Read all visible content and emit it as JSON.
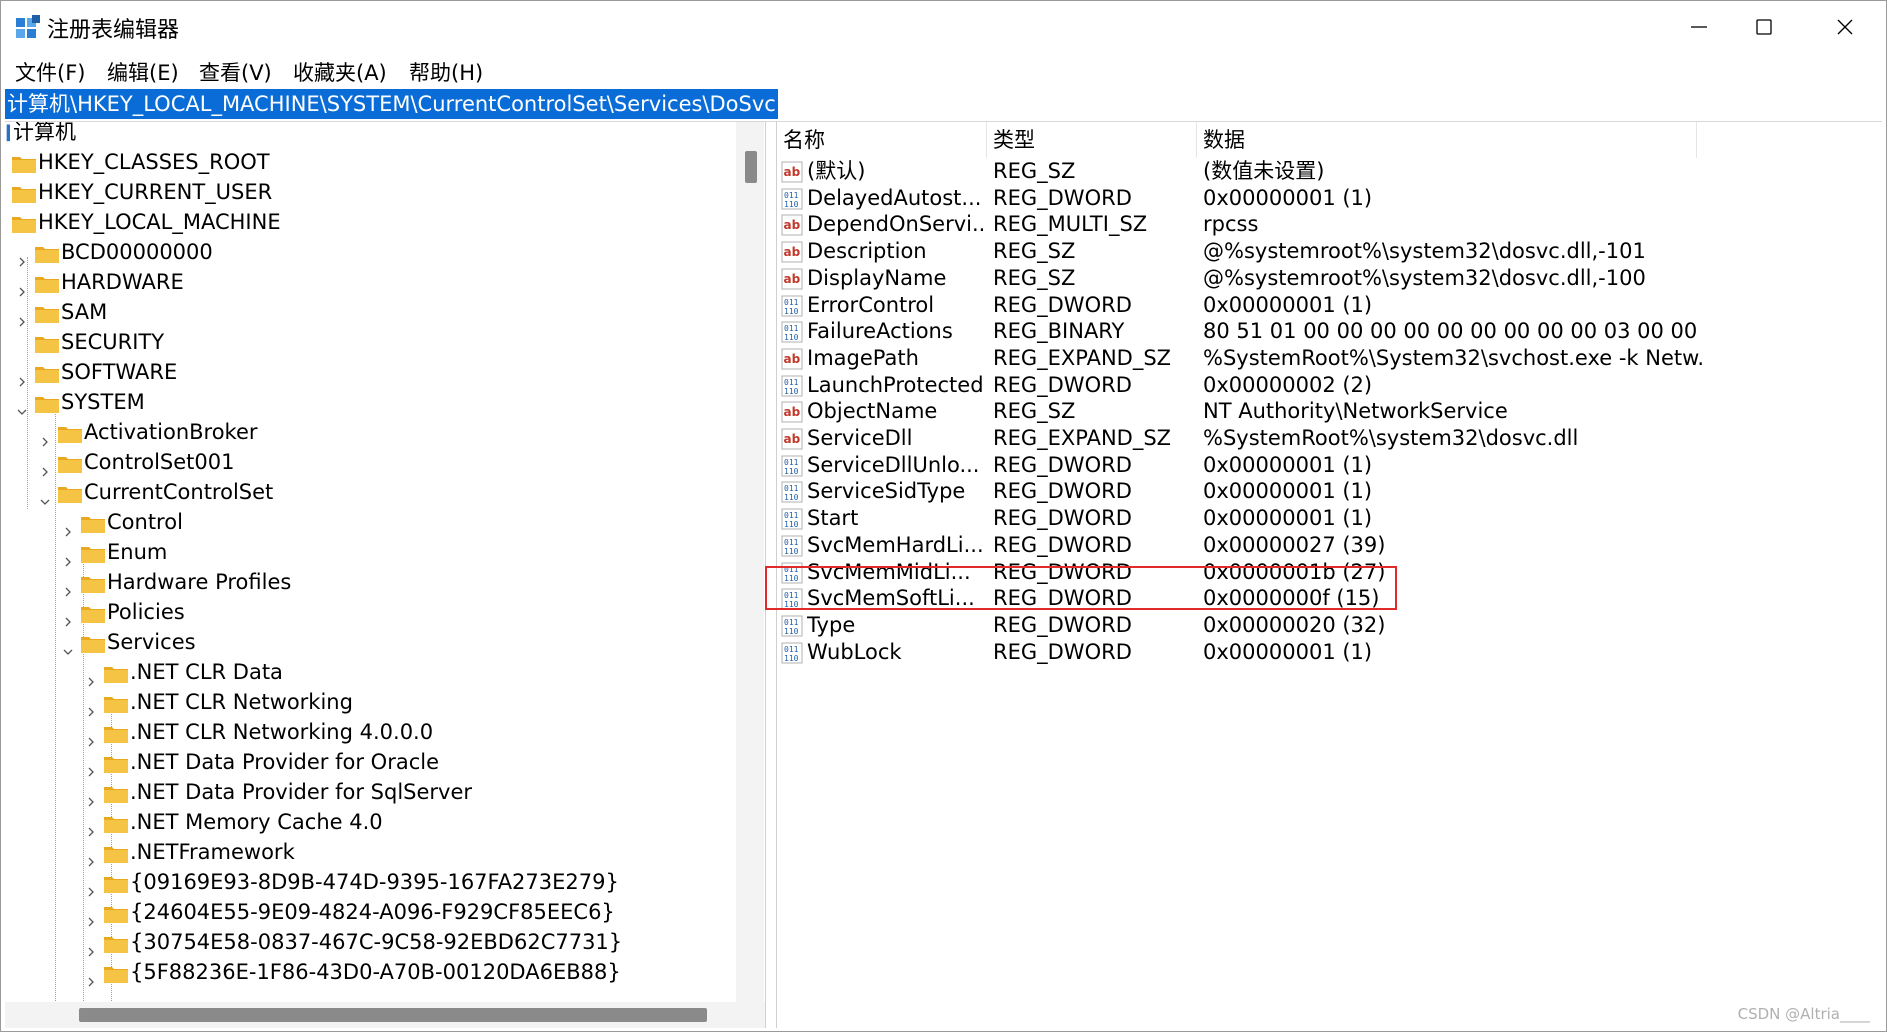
{
  "window": {
    "title": "注册表编辑器"
  },
  "menu": [
    "文件(F)",
    "编辑(E)",
    "查看(V)",
    "收藏夹(A)",
    "帮助(H)"
  ],
  "address": "计算机\\HKEY_LOCAL_MACHINE\\SYSTEM\\CurrentControlSet\\Services\\DoSvc",
  "tree": [
    {
      "label": "计算机",
      "level": 0,
      "chev": "none",
      "folder": false
    },
    {
      "label": "HKEY_CLASSES_ROOT",
      "level": 1,
      "chev": "none",
      "folder": true
    },
    {
      "label": "HKEY_CURRENT_USER",
      "level": 1,
      "chev": "none",
      "folder": true
    },
    {
      "label": "HKEY_LOCAL_MACHINE",
      "level": 1,
      "chev": "none",
      "folder": true
    },
    {
      "label": "BCD00000000",
      "level": 2,
      "chev": "right",
      "folder": true
    },
    {
      "label": "HARDWARE",
      "level": 2,
      "chev": "right",
      "folder": true
    },
    {
      "label": "SAM",
      "level": 2,
      "chev": "right",
      "folder": true
    },
    {
      "label": "SECURITY",
      "level": 2,
      "chev": "none",
      "folder": true
    },
    {
      "label": "SOFTWARE",
      "level": 2,
      "chev": "right",
      "folder": true
    },
    {
      "label": "SYSTEM",
      "level": 2,
      "chev": "down",
      "folder": true
    },
    {
      "label": "ActivationBroker",
      "level": 3,
      "chev": "right",
      "folder": true
    },
    {
      "label": "ControlSet001",
      "level": 3,
      "chev": "right",
      "folder": true
    },
    {
      "label": "CurrentControlSet",
      "level": 3,
      "chev": "down",
      "folder": true
    },
    {
      "label": "Control",
      "level": 4,
      "chev": "right",
      "folder": true
    },
    {
      "label": "Enum",
      "level": 4,
      "chev": "right",
      "folder": true
    },
    {
      "label": "Hardware Profiles",
      "level": 4,
      "chev": "right",
      "folder": true
    },
    {
      "label": "Policies",
      "level": 4,
      "chev": "right",
      "folder": true
    },
    {
      "label": "Services",
      "level": 4,
      "chev": "down",
      "folder": true
    },
    {
      "label": ".NET CLR Data",
      "level": 5,
      "chev": "right",
      "folder": true
    },
    {
      "label": ".NET CLR Networking",
      "level": 5,
      "chev": "right",
      "folder": true
    },
    {
      "label": ".NET CLR Networking 4.0.0.0",
      "level": 5,
      "chev": "right",
      "folder": true
    },
    {
      "label": ".NET Data Provider for Oracle",
      "level": 5,
      "chev": "right",
      "folder": true
    },
    {
      "label": ".NET Data Provider for SqlServer",
      "level": 5,
      "chev": "right",
      "folder": true
    },
    {
      "label": ".NET Memory Cache 4.0",
      "level": 5,
      "chev": "right",
      "folder": true
    },
    {
      "label": ".NETFramework",
      "level": 5,
      "chev": "right",
      "folder": true
    },
    {
      "label": "{09169E93-8D9B-474D-9395-167FA273E279}",
      "level": 5,
      "chev": "right",
      "folder": true
    },
    {
      "label": "{24604E55-9E09-4824-A096-F929CF85EEC6}",
      "level": 5,
      "chev": "right",
      "folder": true
    },
    {
      "label": "{30754E58-0837-467C-9C58-92EBD62C7731}",
      "level": 5,
      "chev": "right",
      "folder": true
    },
    {
      "label": "{5F88236E-1F86-43D0-A70B-00120DA6EB88}",
      "level": 5,
      "chev": "right",
      "folder": true
    }
  ],
  "columns": [
    "名称",
    "类型",
    "数据"
  ],
  "values": [
    {
      "icon": "ab",
      "name": "(默认)",
      "type": "REG_SZ",
      "data": "(数值未设置)"
    },
    {
      "icon": "bin",
      "name": "DelayedAutost...",
      "type": "REG_DWORD",
      "data": "0x00000001 (1)"
    },
    {
      "icon": "ab",
      "name": "DependOnServi...",
      "type": "REG_MULTI_SZ",
      "data": "rpcss"
    },
    {
      "icon": "ab",
      "name": "Description",
      "type": "REG_SZ",
      "data": "@%systemroot%\\system32\\dosvc.dll,-101"
    },
    {
      "icon": "ab",
      "name": "DisplayName",
      "type": "REG_SZ",
      "data": "@%systemroot%\\system32\\dosvc.dll,-100"
    },
    {
      "icon": "bin",
      "name": "ErrorControl",
      "type": "REG_DWORD",
      "data": "0x00000001 (1)"
    },
    {
      "icon": "bin",
      "name": "FailureActions",
      "type": "REG_BINARY",
      "data": "80 51 01 00 00 00 00 00 00 00 00 00 03 00 00 00..."
    },
    {
      "icon": "ab",
      "name": "ImagePath",
      "type": "REG_EXPAND_SZ",
      "data": "%SystemRoot%\\System32\\svchost.exe -k Netw..."
    },
    {
      "icon": "bin",
      "name": "LaunchProtected",
      "type": "REG_DWORD",
      "data": "0x00000002 (2)"
    },
    {
      "icon": "ab",
      "name": "ObjectName",
      "type": "REG_SZ",
      "data": "NT Authority\\NetworkService"
    },
    {
      "icon": "ab",
      "name": "ServiceDll",
      "type": "REG_EXPAND_SZ",
      "data": "%SystemRoot%\\system32\\dosvc.dll"
    },
    {
      "icon": "bin",
      "name": "ServiceDllUnlo...",
      "type": "REG_DWORD",
      "data": "0x00000001 (1)"
    },
    {
      "icon": "bin",
      "name": "ServiceSidType",
      "type": "REG_DWORD",
      "data": "0x00000001 (1)"
    },
    {
      "icon": "bin",
      "name": "Start",
      "type": "REG_DWORD",
      "data": "0x00000001 (1)"
    },
    {
      "icon": "bin",
      "name": "SvcMemHardLi...",
      "type": "REG_DWORD",
      "data": "0x00000027 (39)"
    },
    {
      "icon": "bin",
      "name": "SvcMemMidLi...",
      "type": "REG_DWORD",
      "data": "0x0000001b (27)"
    },
    {
      "icon": "bin",
      "name": "SvcMemSoftLi...",
      "type": "REG_DWORD",
      "data": "0x0000000f (15)"
    },
    {
      "icon": "bin",
      "name": "Type",
      "type": "REG_DWORD",
      "data": "0x00000020 (32)"
    },
    {
      "icon": "bin",
      "name": "WubLock",
      "type": "REG_DWORD",
      "data": "0x00000001 (1)"
    }
  ],
  "highlighted_value": "Start",
  "watermark": "CSDN @Altria____",
  "colors": {
    "selection": "#0a6cd6",
    "highlight_box": "#e02b2b",
    "folder": "#f4c443"
  }
}
